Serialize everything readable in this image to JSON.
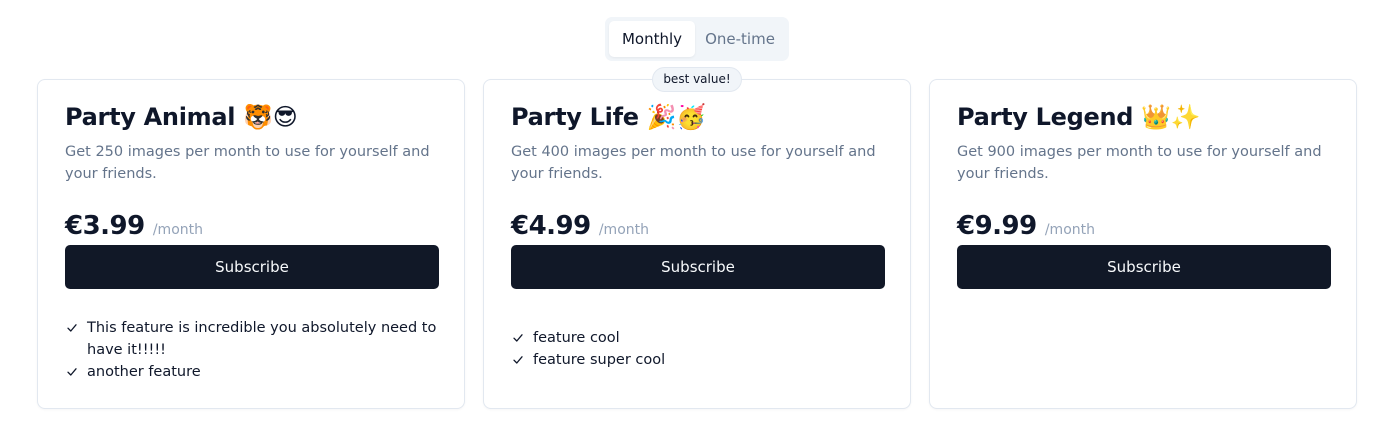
{
  "billing_toggle": {
    "options": [
      "Monthly",
      "One-time"
    ],
    "selected": "Monthly"
  },
  "plans": [
    {
      "title": "Party Animal 🐯😎",
      "description": "Get 250 images per month to use for yourself and your friends.",
      "price": "€3.99",
      "period": "/month",
      "button_label": "Subscribe",
      "features": [
        "This feature is incredible you absolutely need to have it!!!!!",
        "another feature"
      ]
    },
    {
      "title": "Party Life 🎉🥳",
      "badge": "best value!",
      "description": "Get 400 images per month to use for yourself and your friends.",
      "price": "€4.99",
      "period": "/month",
      "button_label": "Subscribe",
      "features": [
        "feature cool",
        "feature super cool"
      ]
    },
    {
      "title": "Party Legend 👑✨",
      "description": "Get 900 images per month to use for yourself and your friends.",
      "price": "€9.99",
      "period": "/month",
      "button_label": "Subscribe",
      "features": []
    }
  ],
  "icons": {
    "feature_check": "check-icon"
  },
  "colors": {
    "button": "#111827",
    "muted_text": "#64748b",
    "border": "#e2e8f0",
    "toggle_bg": "#f1f5f9"
  }
}
